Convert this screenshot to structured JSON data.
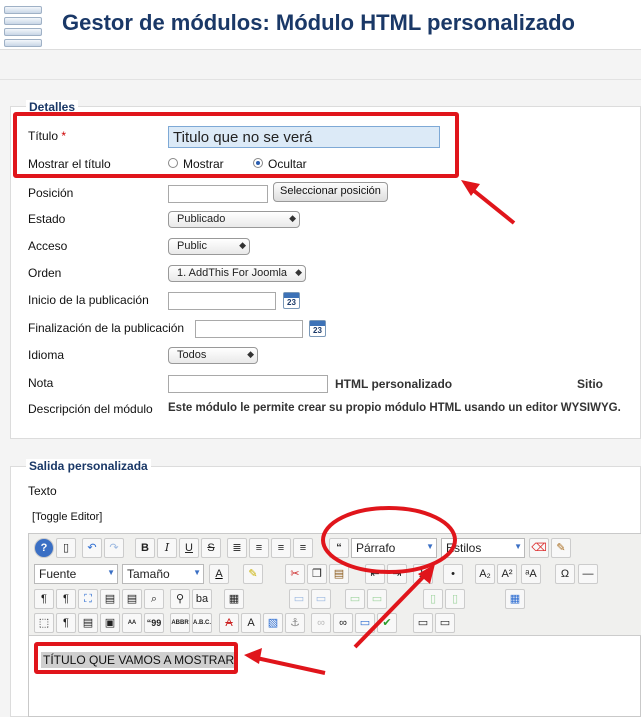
{
  "header": {
    "title": "Gestor de módulos: Módulo HTML personalizado",
    "logo_icon": "module-manager-icon"
  },
  "detalles": {
    "legend": "Detalles",
    "titulo": {
      "label": "Título",
      "required_mark": "*",
      "value": "Titulo que no se verá"
    },
    "mostrar_titulo": {
      "label": "Mostrar el título",
      "options": [
        "Mostrar",
        "Ocultar"
      ],
      "selected": "Ocultar"
    },
    "posicion": {
      "label": "Posición",
      "value": "",
      "button": "Seleccionar posición"
    },
    "estado": {
      "label": "Estado",
      "value": "Publicado"
    },
    "acceso": {
      "label": "Acceso",
      "value": "Public"
    },
    "orden": {
      "label": "Orden",
      "value": "1. AddThis For Joomla"
    },
    "inicio": {
      "label": "Inicio de la publicación",
      "value": "",
      "calendar_day": "23"
    },
    "finalizacion": {
      "label": "Finalización de la publicación",
      "value": "",
      "calendar_day": "23"
    },
    "idioma": {
      "label": "Idioma",
      "value": "Todos"
    },
    "nota": {
      "label": "Nota",
      "value": "",
      "module_type": "HTML personalizado",
      "site": "Sitio"
    },
    "descripcion": {
      "label": "Descripción del módulo",
      "value": "Este módulo le permite crear su propio módulo HTML usando un editor WYSIWYG."
    }
  },
  "salida": {
    "legend": "Salida personalizada",
    "texto_label": "Texto",
    "toggle_editor": "[Toggle Editor]",
    "format_select": "Párrafo",
    "styles_select": "Estilos",
    "font_select": "Fuente",
    "size_select": "Tamaño",
    "content": "TÍTULO QUE VAMOS A MOSTRAR"
  },
  "toolbar_icons": {
    "row1": [
      "help-icon",
      "new-document-icon",
      "undo-icon",
      "redo-icon",
      "bold-icon",
      "italic-icon",
      "underline-icon",
      "strikethrough-icon",
      "align-justify-icon",
      "align-center-icon",
      "align-left-icon",
      "align-right-icon",
      "blockquote-icon",
      "eraser-icon",
      "cleanup-broom-icon"
    ],
    "row2": [
      "text-color-icon",
      "highlight-color-icon",
      "cut-icon",
      "copy-icon",
      "paste-icon",
      "outdent-icon",
      "indent-icon",
      "ordered-list-icon",
      "unordered-list-icon",
      "subscript-icon",
      "superscript-icon",
      "change-case-icon",
      "special-char-icon",
      "horizontal-rule-icon"
    ],
    "row3": [
      "ltr-icon",
      "rtl-icon",
      "fullscreen-icon",
      "paste-text-icon",
      "paste-word-icon",
      "find-icon",
      "find-replace-icon",
      "spellcheck-icon",
      "insert-table-icon",
      "table-row-before-icon",
      "table-row-after-icon",
      "table-delete-row-icon",
      "table-col-before-icon",
      "table-col-after-icon",
      "table-delete-col-icon",
      "table-props-icon"
    ],
    "row4": [
      "visual-aid-icon",
      "show-blocks-icon",
      "template-icon",
      "layer-icon",
      "acronym-icon",
      "citation-icon",
      "abbreviation-icon",
      "abbr-abc-icon",
      "remove-format-icon",
      "attributes-icon",
      "image-icon",
      "anchor-icon",
      "unlink-icon",
      "link-icon",
      "media-icon",
      "spellchecker-icon",
      "horizontal-line-icon",
      "page-break-icon"
    ]
  },
  "annotation_color": "#e0151b"
}
